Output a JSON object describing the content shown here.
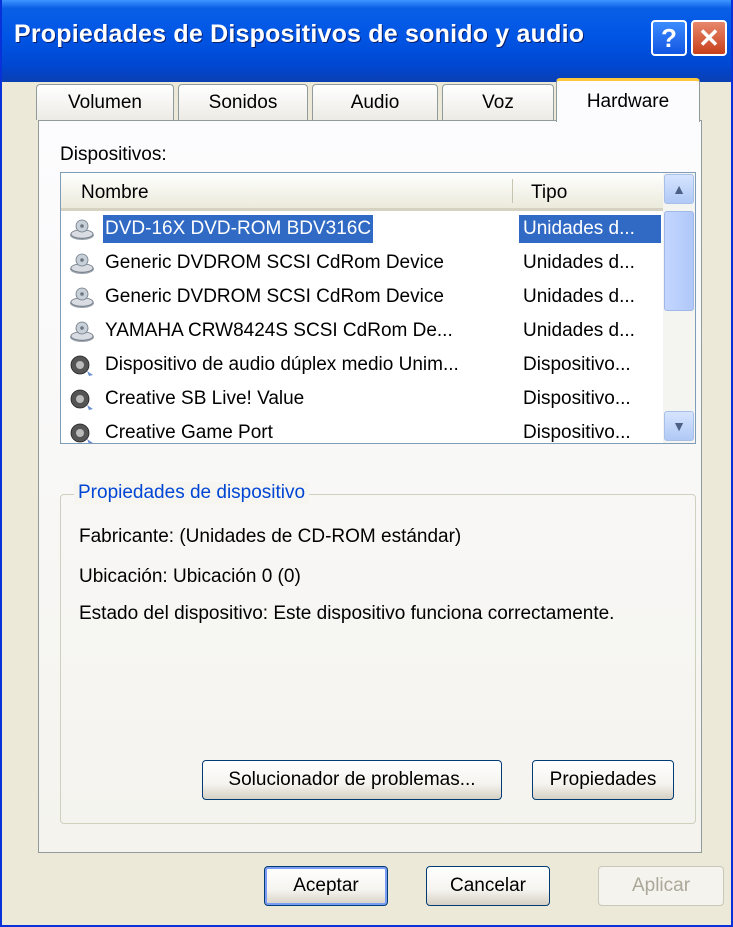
{
  "window": {
    "title": "Propiedades de Dispositivos de sonido y audio",
    "help_glyph": "?",
    "close_glyph": "✕"
  },
  "tabs": [
    {
      "label": "Volumen",
      "active": false
    },
    {
      "label": "Sonidos",
      "active": false
    },
    {
      "label": "Audio",
      "active": false
    },
    {
      "label": "Voz",
      "active": false
    },
    {
      "label": "Hardware",
      "active": true
    }
  ],
  "devices": {
    "label": "Dispositivos:",
    "columns": {
      "name": "Nombre",
      "type": "Tipo"
    },
    "rows": [
      {
        "name": "DVD-16X DVD-ROM BDV316C",
        "type": "Unidades d...",
        "icon": "cdrom-icon",
        "selected": true
      },
      {
        "name": "Generic DVDROM SCSI CdRom Device",
        "type": "Unidades d...",
        "icon": "cdrom-icon",
        "selected": false
      },
      {
        "name": "Generic DVDROM SCSI CdRom Device",
        "type": "Unidades d...",
        "icon": "cdrom-icon",
        "selected": false
      },
      {
        "name": "YAMAHA CRW8424S SCSI CdRom De...",
        "type": "Unidades d...",
        "icon": "cdrom-icon",
        "selected": false
      },
      {
        "name": "Dispositivo de audio dúplex medio Unim...",
        "type": "Dispositivo...",
        "icon": "speaker-icon",
        "selected": false
      },
      {
        "name": "Creative SB Live! Value",
        "type": "Dispositivo...",
        "icon": "speaker-icon",
        "selected": false
      },
      {
        "name": "Creative Game Port",
        "type": "Dispositivo...",
        "icon": "speaker-icon",
        "selected": false
      }
    ]
  },
  "properties": {
    "title": "Propiedades de dispositivo",
    "manufacturer": "Fabricante: (Unidades de CD-ROM estándar)",
    "location": "Ubicación: Ubicación 0 (0)",
    "status": "Estado del dispositivo: Este dispositivo funciona correctamente.",
    "troubleshoot_label": "Solucionador de problemas...",
    "properties_label": "Propiedades"
  },
  "footer": {
    "ok_label": "Aceptar",
    "cancel_label": "Cancelar",
    "apply_label": "Aplicar"
  },
  "colors": {
    "titlebar": "#0055e5",
    "selection": "#316ac5",
    "group_title": "#0046d5"
  }
}
